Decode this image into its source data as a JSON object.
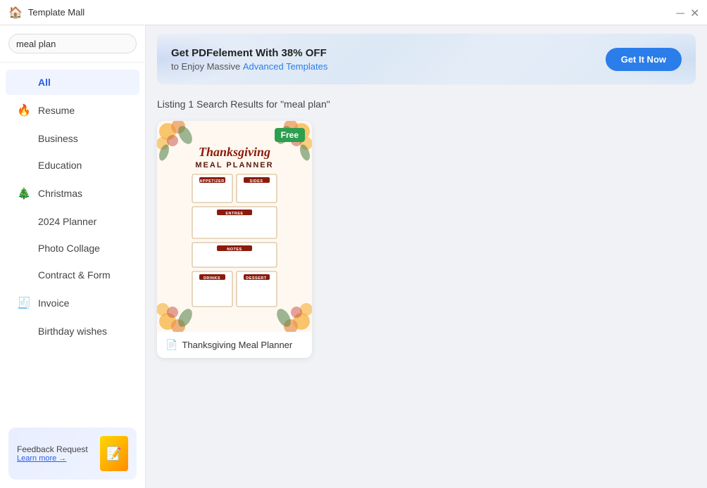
{
  "titleBar": {
    "title": "Template Mall",
    "icon": "🏠"
  },
  "sidebar": {
    "searchPlaceholder": "meal plan",
    "searchValue": "meal plan",
    "navItems": [
      {
        "id": "all",
        "label": "All",
        "icon": "",
        "active": true
      },
      {
        "id": "resume",
        "label": "Resume",
        "icon": "🔥"
      },
      {
        "id": "business",
        "label": "Business",
        "icon": ""
      },
      {
        "id": "education",
        "label": "Education",
        "icon": ""
      },
      {
        "id": "christmas",
        "label": "Christmas",
        "icon": "🎄"
      },
      {
        "id": "planner",
        "label": "2024 Planner",
        "icon": ""
      },
      {
        "id": "photo-collage",
        "label": "Photo Collage",
        "icon": ""
      },
      {
        "id": "contract",
        "label": "Contract & Form",
        "icon": ""
      },
      {
        "id": "invoice",
        "label": "Invoice",
        "icon": "🧾"
      },
      {
        "id": "birthday",
        "label": "Birthday wishes",
        "icon": ""
      }
    ],
    "feedback": {
      "title": "Feedback Request",
      "link": "Learn more →"
    }
  },
  "banner": {
    "title": "Get PDFelement With 38% OFF",
    "subtitle": "to Enjoy Massive ",
    "subtitleHighlight": "Advanced Templates",
    "buttonLabel": "Get It Now"
  },
  "results": {
    "header": "Listing 1 Search Results for \"meal plan\"",
    "cards": [
      {
        "id": "thanksgiving-meal-planner",
        "badge": "Free",
        "title": "Thanksgiving Meal Planner",
        "iconLabel": "📄"
      }
    ]
  },
  "mealPlanner": {
    "cursiveTitle": "Thanksgiving",
    "mainTitle": "MEAL PLANNER",
    "sections": [
      {
        "label": "APPETIZER",
        "type": "two-col-first"
      },
      {
        "label": "SIDES",
        "type": "two-col-second"
      },
      {
        "label": "ENTREE",
        "type": "full"
      },
      {
        "label": "NOTES",
        "type": "full"
      },
      {
        "label": "DRINKS",
        "type": "two-col-first"
      },
      {
        "label": "DESSERT",
        "type": "two-col-second"
      }
    ]
  }
}
